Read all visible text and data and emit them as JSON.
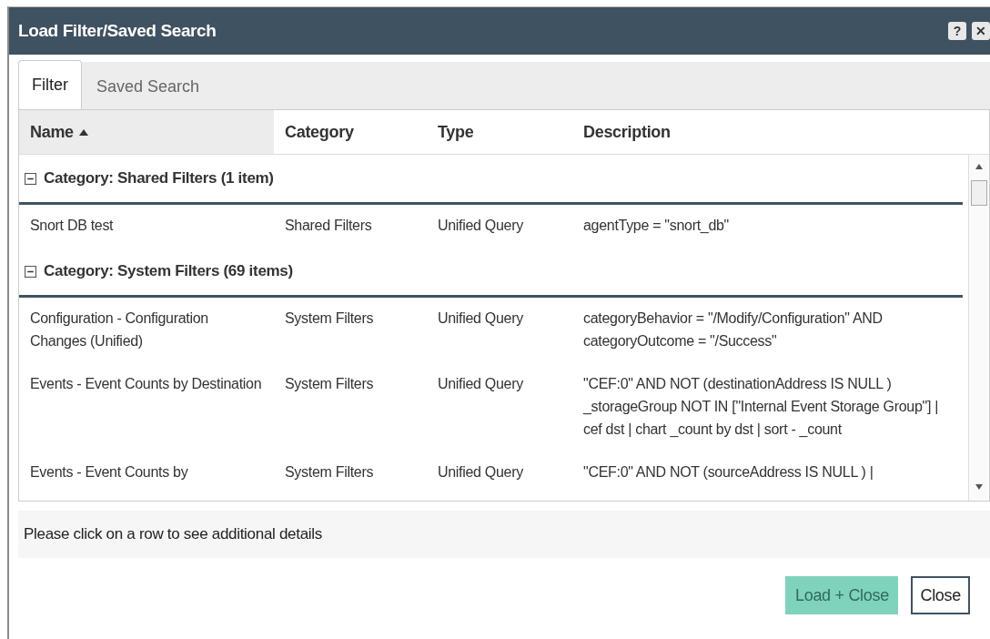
{
  "window": {
    "title": "Load Filter/Saved Search",
    "help": "?",
    "close": "✕"
  },
  "tabs": [
    {
      "label": "Filter",
      "selected": true
    },
    {
      "label": "Saved Search",
      "selected": false
    }
  ],
  "table": {
    "columns": [
      {
        "label": "Name",
        "sorted": true
      },
      {
        "label": "Category",
        "sorted": false
      },
      {
        "label": "Type",
        "sorted": false
      },
      {
        "label": "Description",
        "sorted": false
      }
    ],
    "groups": [
      {
        "label": "Category: Shared Filters (1 item)",
        "expanded": true,
        "rows": [
          [
            "Snort DB test",
            "Shared Filters",
            "Unified Query",
            "agentType = \"snort_db\""
          ]
        ]
      },
      {
        "label": "Category: System Filters (69 items)",
        "expanded": true,
        "rows": [
          [
            "Configuration - Configuration Changes (Unified)",
            "System Filters",
            "Unified Query",
            "categoryBehavior = \"/Modify/Configuration\" AND categoryOutcome = \"/Success\""
          ],
          [
            "Events - Event Counts by Destination",
            "System Filters",
            "Unified Query",
            "\"CEF:0\" AND NOT (destinationAddress IS NULL ) _storageGroup NOT IN [\"Internal Event Storage Group\"] | cef dst | chart _count by dst | sort - _count"
          ],
          [
            "Events - Event Counts by",
            "System Filters",
            "Unified Query",
            "\"CEF:0\" AND NOT (sourceAddress IS NULL ) |"
          ]
        ]
      }
    ]
  },
  "status": "Please click on a row to see additional details",
  "buttons": [
    {
      "label": "Load + Close",
      "kind": "primary",
      "disabled": true
    },
    {
      "label": "Close",
      "kind": "secondary",
      "disabled": false
    }
  ]
}
